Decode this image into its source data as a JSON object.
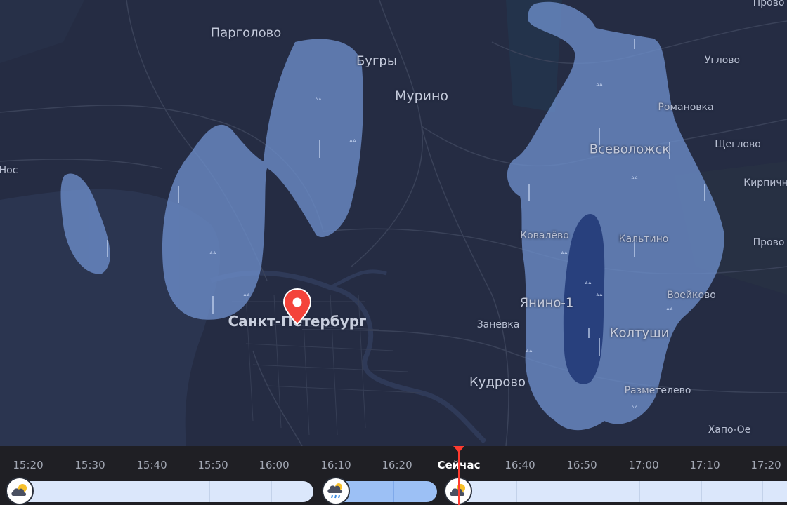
{
  "map": {
    "places": [
      {
        "name": "Парголово",
        "size": "big"
      },
      {
        "name": "Бугры",
        "size": "big"
      },
      {
        "name": "Мурино",
        "size": "big"
      },
      {
        "name": "Углово",
        "size": "sm"
      },
      {
        "name": "Романовка",
        "size": "sm"
      },
      {
        "name": "Всеволожск",
        "size": "big"
      },
      {
        "name": "Щеглово",
        "size": "sm"
      },
      {
        "name": "Кирпичн",
        "size": "sm"
      },
      {
        "name": "Нос",
        "size": "sm"
      },
      {
        "name": "Ковалёво",
        "size": "sm"
      },
      {
        "name": "Кальтино",
        "size": "sm"
      },
      {
        "name": "Янино-1",
        "size": "big"
      },
      {
        "name": "Воейково",
        "size": "sm"
      },
      {
        "name": "Санкт-Петербург",
        "size": "city"
      },
      {
        "name": "Заневка",
        "size": "sm"
      },
      {
        "name": "Колтуши",
        "size": "big"
      },
      {
        "name": "Кудрово",
        "size": "big"
      },
      {
        "name": "Разметелево",
        "size": "sm"
      },
      {
        "name": "Хапо-Ое",
        "size": "sm"
      },
      {
        "name": "Прово",
        "size": "sm"
      },
      {
        "name": "Прово",
        "size": "sm"
      }
    ],
    "pin_icon": "location-pin-icon",
    "colors": {
      "water": "#2b3550",
      "land": "#252c43",
      "rain_light": "#6d8ecb",
      "rain_heavy": "#223a78"
    }
  },
  "timeline": {
    "ticks": [
      "15:20",
      "15:30",
      "15:40",
      "15:50",
      "16:00",
      "16:10",
      "16:20",
      "Сейчас",
      "16:40",
      "16:50",
      "17:00",
      "17:10",
      "17:20"
    ],
    "now_label": "Сейчас",
    "colors": {
      "now_marker": "#ff3b30",
      "light_rain": "#dbe7fb",
      "rain": "#9cc0f5"
    },
    "icons": [
      "partly-cloudy-icon",
      "cloud-rain-icon",
      "partly-cloudy-icon"
    ]
  }
}
